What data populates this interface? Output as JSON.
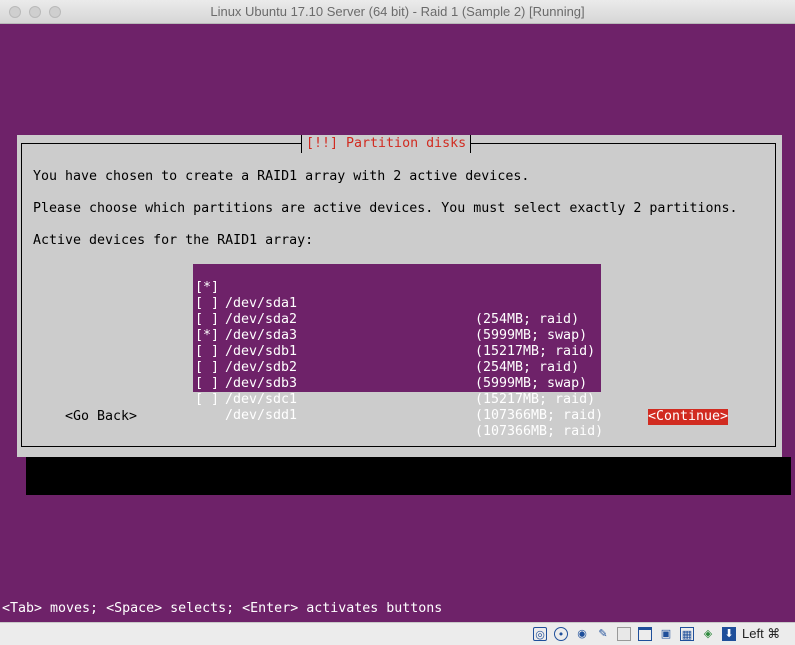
{
  "window": {
    "title": "Linux Ubuntu 17.10 Server (64 bit) - Raid 1 (Sample 2) [Running]"
  },
  "installer": {
    "dialog_title": "[!!] Partition disks",
    "message1": "You have chosen to create a RAID1 array with 2 active devices.",
    "message2": "Please choose which partitions are active devices. You must select exactly 2 partitions.",
    "prompt": "Active devices for the RAID1 array:",
    "devices": [
      {
        "checkbox": "[*]",
        "device": "/dev/sda1",
        "info": "(254MB; raid)"
      },
      {
        "checkbox": "[ ]",
        "device": "/dev/sda2",
        "info": "(5999MB; swap)"
      },
      {
        "checkbox": "[ ]",
        "device": "/dev/sda3",
        "info": "(15217MB; raid)"
      },
      {
        "checkbox": "[*]",
        "device": "/dev/sdb1",
        "info": "(254MB; raid)"
      },
      {
        "checkbox": "[ ]",
        "device": "/dev/sdb2",
        "info": "(5999MB; swap)"
      },
      {
        "checkbox": "[ ]",
        "device": "/dev/sdb3",
        "info": "(15217MB; raid)"
      },
      {
        "checkbox": "[ ]",
        "device": "/dev/sdc1",
        "info": "(107366MB; raid)"
      },
      {
        "checkbox": "[ ]",
        "device": "/dev/sdd1",
        "info": "(107366MB; raid)"
      }
    ],
    "go_back": "<Go Back>",
    "continue": "<Continue>",
    "help": "<Tab> moves; <Space> selects; <Enter> activates buttons"
  },
  "statusbar": {
    "icons": [
      "hard-disk-icon",
      "optical-drive-icon",
      "audio-icon",
      "usb-icon",
      "shared-folder-icon",
      "display-icon",
      "screen-capture-icon",
      "video-capture-icon",
      "network-icon",
      "mouse-integration-icon"
    ],
    "host_key": "Left ⌘"
  },
  "colors": {
    "screen_bg": "#6e2269",
    "dialog_bg": "#cccccc",
    "accent_red": "#d12b20"
  }
}
